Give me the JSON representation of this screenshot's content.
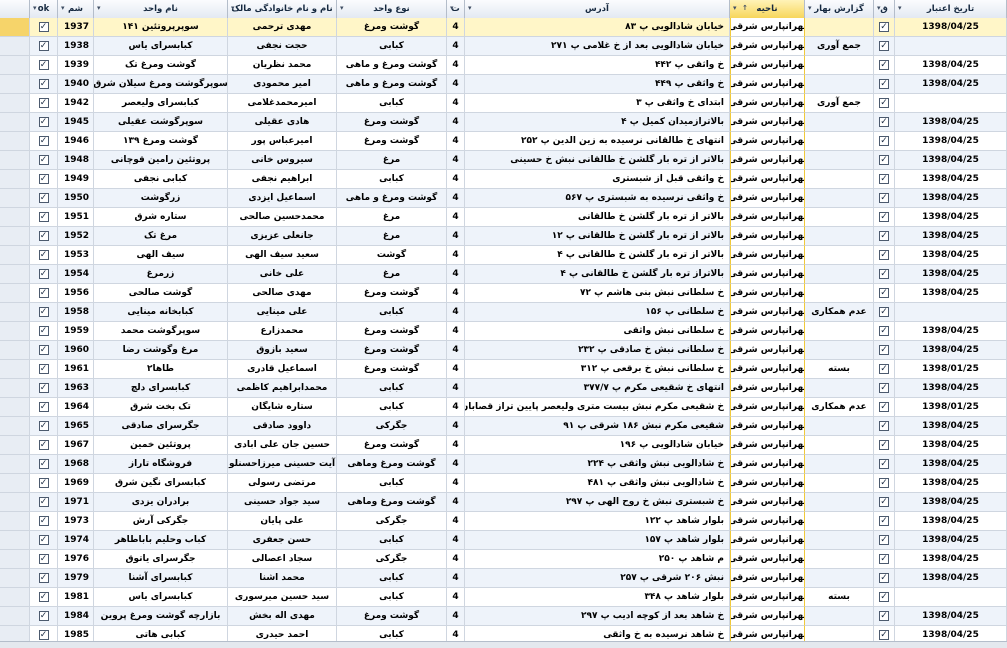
{
  "columns": [
    {
      "key": "date",
      "label": "تاریخ اعتبار"
    },
    {
      "key": "q",
      "label": "ق"
    },
    {
      "key": "report",
      "label": "گزارش بهار"
    },
    {
      "key": "district",
      "label": "ناحیه"
    },
    {
      "key": "address",
      "label": "آدرس"
    },
    {
      "key": "t",
      "label": "ت"
    },
    {
      "key": "type",
      "label": "نوع واحد"
    },
    {
      "key": "owner",
      "label": "نام و نام خانوادگی مالک"
    },
    {
      "key": "unit",
      "label": "نام واحد"
    },
    {
      "key": "id",
      "label": "شم"
    },
    {
      "key": "ok",
      "label": "ok"
    }
  ],
  "rows": [
    {
      "date": "1398/04/25",
      "report": "",
      "district": "تهرانپارس شرقی",
      "address": "خیابان شادالویی پ ۸۳",
      "t": "4",
      "type": "گوشت ومرغ",
      "owner": "مهدی ترحمی",
      "unit": "سوپرپروتئین ۱۴۱",
      "id": "1937"
    },
    {
      "date": "",
      "report": "جمع آوری",
      "district": "تهرانپارس شرقی",
      "address": "خیابان شادالویی بعد از خ غلامی پ ۲۷۱",
      "t": "4",
      "type": "کبابی",
      "owner": "حجت نجفی",
      "unit": "کبابسرای یاس",
      "id": "1938"
    },
    {
      "date": "1398/04/25",
      "report": "",
      "district": "تهرانپارس شرقی",
      "address": "خ واثقی پ ۴۴۲",
      "t": "4",
      "type": "گوشت ومرغ و ماهی",
      "owner": "محمد نظریان",
      "unit": "گوشت ومرغ تک",
      "id": "1939"
    },
    {
      "date": "1398/04/25",
      "report": "",
      "district": "تهرانپارس شرقی",
      "address": "خ واثقی پ ۴۴۹",
      "t": "4",
      "type": "گوشت ومرغ و ماهی",
      "owner": "امیر محمودی",
      "unit": "سوپرگوشت ومرغ سیلان شرق",
      "id": "1940"
    },
    {
      "date": "",
      "report": "جمع آوری",
      "district": "تهرانپارس شرقی",
      "address": "ابتدای خ واثقی پ ۳",
      "t": "4",
      "type": "کبابی",
      "owner": "امیرمحمدغلامی",
      "unit": "کبابسرای ولیعصر",
      "id": "1942"
    },
    {
      "date": "1398/04/25",
      "report": "",
      "district": "تهرانپارس شرقی",
      "address": "بالاترازمیدان کمیل پ ۴",
      "t": "4",
      "type": "گوشت ومرغ",
      "owner": "هادی عقیلی",
      "unit": "سوپرگوشت عقیلی",
      "id": "1945"
    },
    {
      "date": "1398/04/25",
      "report": "",
      "district": "تهرانپارس شرقی",
      "address": "انتهای خ طالقانی نرسیده به زین الدین پ ۲۵۲",
      "t": "4",
      "type": "گوشت ومرغ",
      "owner": "امیرعباس پور",
      "unit": "گوشت ومرغ ۱۳۹",
      "id": "1946"
    },
    {
      "date": "1398/04/25",
      "report": "",
      "district": "تهرانپارس شرقی",
      "address": "بالاتر از تره بار گلشن خ طالقانی نبش خ حسینی",
      "t": "4",
      "type": "مرغ",
      "owner": "سیروس خانی",
      "unit": "پروتئین رامین قوچانی",
      "id": "1948"
    },
    {
      "date": "1398/04/25",
      "report": "",
      "district": "تهرانپارس شرقی",
      "address": "خ واثقی قبل از شبستری",
      "t": "4",
      "type": "کبابی",
      "owner": "ابراهیم نجفی",
      "unit": "کبابی نجفی",
      "id": "1949"
    },
    {
      "date": "1398/04/25",
      "report": "",
      "district": "تهرانپارس شرقی",
      "address": "خ واثقی نرسیده به شبستری پ ۵۶۷",
      "t": "4",
      "type": "گوشت ومرغ و ماهی",
      "owner": "اسماعیل ایزدی",
      "unit": "زرگوشت",
      "id": "1950"
    },
    {
      "date": "1398/04/25",
      "report": "",
      "district": "تهرانپارس شرقی",
      "address": "بالاتر از تره بار گلشن خ طالقانی",
      "t": "4",
      "type": "مرغ",
      "owner": "محمدحسین صالحی",
      "unit": "ستاره شرق",
      "id": "1951"
    },
    {
      "date": "1398/04/25",
      "report": "",
      "district": "تهرانپارس شرقی",
      "address": "بالاتر از تره بار گلشن خ طالقانی پ ۱۲",
      "t": "4",
      "type": "مرغ",
      "owner": "جانعلی عزیزی",
      "unit": "مرغ تک",
      "id": "1952"
    },
    {
      "date": "1398/04/25",
      "report": "",
      "district": "تهرانپارس شرقی",
      "address": "بالاتر از تره بار گلشن خ طالقانی پ ۴",
      "t": "4",
      "type": "گوشت",
      "owner": "سعید سیف الهی",
      "unit": "سیف الهی",
      "id": "1953"
    },
    {
      "date": "1398/04/25",
      "report": "",
      "district": "تهرانپارس شرقی",
      "address": "بالاتراز تره بار گلشن خ طالقانی پ ۴",
      "t": "4",
      "type": "مرغ",
      "owner": "علی خانی",
      "unit": "زرمرغ",
      "id": "1954"
    },
    {
      "date": "1398/04/25",
      "report": "",
      "district": "تهرانپارس شرقی",
      "address": "خ سلطانی نبش بنی هاشم پ ۷۲",
      "t": "4",
      "type": "گوشت ومرغ",
      "owner": "مهدی صالحی",
      "unit": "گوشت صالحی",
      "id": "1956"
    },
    {
      "date": "",
      "report": "عدم همکاری",
      "district": "تهرانپارس شرقی",
      "address": "خ سلطانی پ ۱۵۶",
      "t": "4",
      "type": "کبابی",
      "owner": "علی مینایی",
      "unit": "کبابخانه مینایی",
      "id": "1958"
    },
    {
      "date": "1398/04/25",
      "report": "",
      "district": "تهرانپارس شرقی",
      "address": "خ سلطانی نبش واثقی",
      "t": "4",
      "type": "گوشت ومرغ",
      "owner": "محمدزارع",
      "unit": "سوپرگوشت محمد",
      "id": "1959"
    },
    {
      "date": "1398/04/25",
      "report": "",
      "district": "تهرانپارس شرقی",
      "address": "خ سلطانی نبش خ صادقی پ ۲۳۲",
      "t": "4",
      "type": "گوشت ومرغ",
      "owner": "سعید بازوق",
      "unit": "مرغ وگوشت رضا",
      "id": "1960"
    },
    {
      "date": "1398/01/25",
      "report": "بسته",
      "district": "تهرانپارس شرقی",
      "address": "خ سلطانی نبش خ برقعی پ ۳۱۲",
      "t": "4",
      "type": "گوشت ومرغ",
      "owner": "اسماعیل قادری",
      "unit": "طاها۲",
      "id": "1961"
    },
    {
      "date": "1398/04/25",
      "report": "",
      "district": "تهرانپارس شرقی",
      "address": "انتهای خ شقیعی مکرم پ ۳۷۷/۷",
      "t": "4",
      "type": "کبابی",
      "owner": "محمدابراهیم کاظمی",
      "unit": "کبابسرای دلچ",
      "id": "1963"
    },
    {
      "date": "1398/01/25",
      "report": "عدم همکاری",
      "district": "تهرانپارس شرقی",
      "address": "خ  شقیعی مکرم نبش بیست متری ولیعصر پایین تراز قصابان",
      "t": "4",
      "type": "کبابی",
      "owner": "ستاره شایگان",
      "unit": "تک بخت شرق",
      "id": "1964"
    },
    {
      "date": "1398/04/25",
      "report": "",
      "district": "تهرانپارس شرقی",
      "address": "شقیعی مکرم نبش ۱۸۶ شرقی پ ۹۱",
      "t": "4",
      "type": "جگرکی",
      "owner": "داوود صادقی",
      "unit": "جگرسرای صادقی",
      "id": "1965"
    },
    {
      "date": "1398/04/25",
      "report": "",
      "district": "تهرانپارس شرقی",
      "address": "خیابان شادالویی پ ۱۹۶",
      "t": "4",
      "type": "گوشت ومرغ",
      "owner": "حسین جان علی ابادی",
      "unit": "پروتئین خمین",
      "id": "1967"
    },
    {
      "date": "1398/04/25",
      "report": "",
      "district": "تهرانپارس شرقی",
      "address": "خ شادالویی نبش واثقی پ ۲۲۴",
      "t": "4",
      "type": "گوشت ومرغ وماهی",
      "owner": "آیت حسینی میرزاحسنلو",
      "unit": "فروشگاه تاراز",
      "id": "1968"
    },
    {
      "date": "1398/04/25",
      "report": "",
      "district": "تهرانپارس شرقی",
      "address": "خ شادالویی نبش واثقی پ ۴۸۱",
      "t": "4",
      "type": "کبابی",
      "owner": "مرتضی رسولی",
      "unit": "کبابسرای نگین شرق",
      "id": "1969"
    },
    {
      "date": "1398/04/25",
      "report": "",
      "district": "تهرانپارس شرقی",
      "address": "خ شبستری نبش خ روح الهی پ ۲۹۷",
      "t": "4",
      "type": "گوشت ومرغ وماهی",
      "owner": "سید جواد حسینی",
      "unit": "برادران یزدی",
      "id": "1971"
    },
    {
      "date": "1398/04/25",
      "report": "",
      "district": "تهرانپارس شرقی",
      "address": "بلوار شاهد پ ۱۲۲",
      "t": "4",
      "type": "جگرکی",
      "owner": "علی پایان",
      "unit": "جگرکی آرش",
      "id": "1973"
    },
    {
      "date": "1398/04/25",
      "report": "",
      "district": "تهرانپارس شرقی",
      "address": "بلوار شاهد پ ۱۵۷",
      "t": "4",
      "type": "کبابی",
      "owner": "حسن جعفری",
      "unit": "کباب وحلیم باباطاهر",
      "id": "1974"
    },
    {
      "date": "1398/04/25",
      "report": "",
      "district": "تهرانپارس شرقی",
      "address": "م شاهد پ ۲۵۰",
      "t": "4",
      "type": "جگرکی",
      "owner": "سجاد اعصالی",
      "unit": "جگرسرای یاتوق",
      "id": "1976"
    },
    {
      "date": "1398/04/25",
      "report": "",
      "district": "تهرانپارس شرقی",
      "address": "نبش ۲۰۶ شرقی پ ۲۵۷",
      "t": "4",
      "type": "کبابی",
      "owner": "محمد اشنا",
      "unit": "کبابسرای آشنا",
      "id": "1979"
    },
    {
      "date": "",
      "report": "بسته",
      "district": "تهرانپارس شرقی",
      "address": "بلوار شاهد پ ۳۴۸",
      "t": "4",
      "type": "کبابی",
      "owner": "سید حسین میرسوری",
      "unit": "کبابسرای یاس",
      "id": "1981"
    },
    {
      "date": "1398/04/25",
      "report": "",
      "district": "تهرانپارس شرقی",
      "address": "خ شاهد بعد از کوچه ادیب پ ۲۹۷",
      "t": "4",
      "type": "گوشت ومرغ",
      "owner": "مهدی اله بخش",
      "unit": "بازارچه گوشت ومرغ پروین",
      "id": "1984"
    },
    {
      "date": "1398/04/25",
      "report": "",
      "district": "تهرانپارس شرقی",
      "address": "خ شاهد نرسیده به خ واثقی",
      "t": "4",
      "type": "کبابی",
      "owner": "احمد حیدری",
      "unit": "کبابی هاتی",
      "id": "1985"
    }
  ]
}
